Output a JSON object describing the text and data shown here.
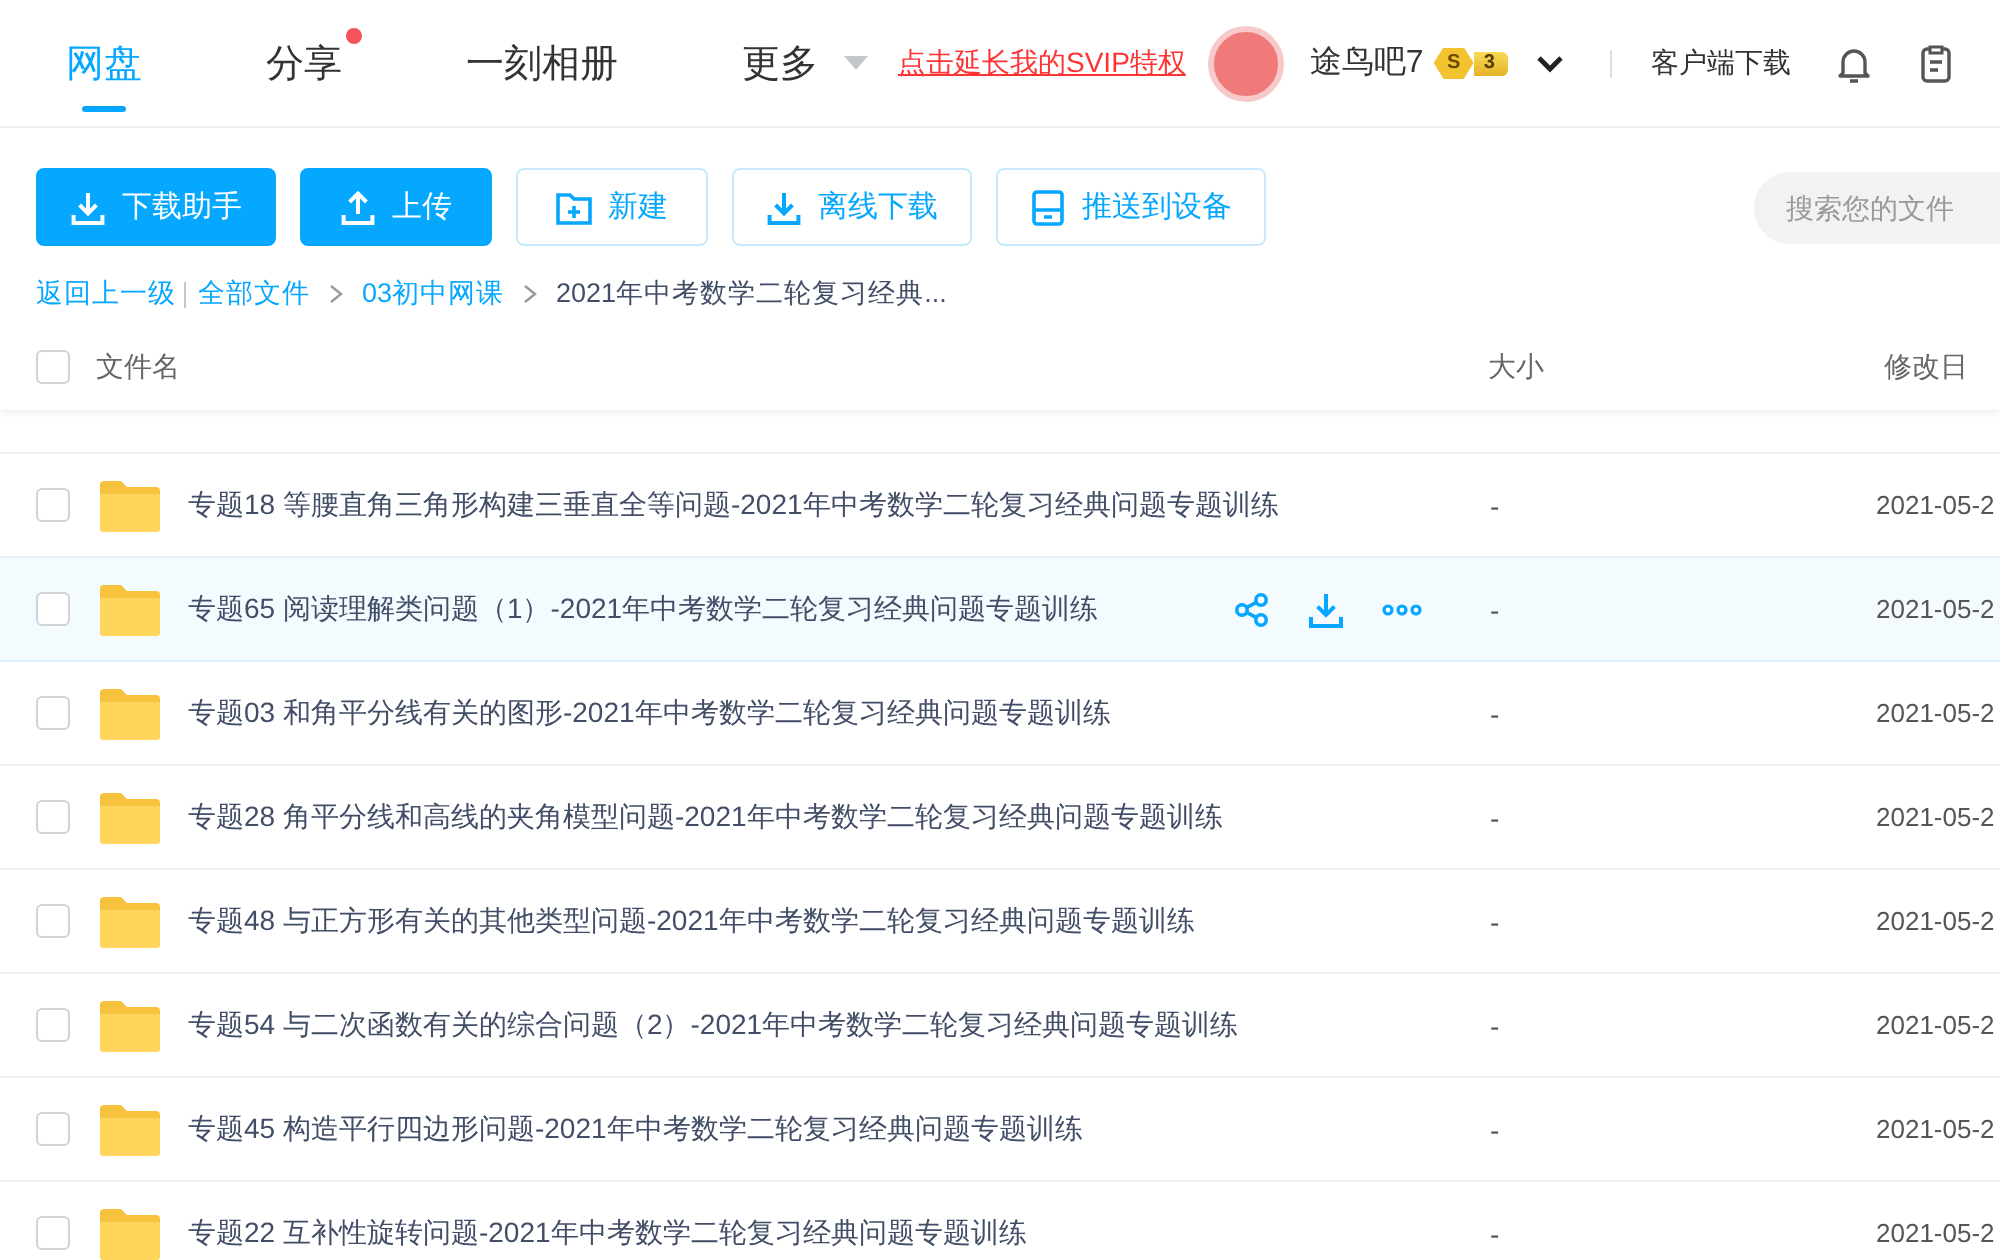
{
  "nav": {
    "tabs": [
      {
        "label": "网盘",
        "selected": true,
        "dot": false
      },
      {
        "label": "分享",
        "selected": false,
        "dot": true
      },
      {
        "label": "一刻相册",
        "selected": false,
        "dot": false
      },
      {
        "label": "更多",
        "selected": false,
        "dot": false,
        "dropdown": true
      }
    ],
    "promo_link": "点击延长我的SVIP特权",
    "user": {
      "name": "途鸟吧7",
      "badge_letter": "S",
      "badge_number": "3"
    },
    "client_download": "客户端下载"
  },
  "toolbar": {
    "buttons": [
      {
        "label": "下载助手",
        "kind": "download",
        "filled": true
      },
      {
        "label": "上传",
        "kind": "upload",
        "filled": true
      },
      {
        "label": "新建",
        "kind": "new-folder",
        "filled": false
      },
      {
        "label": "离线下载",
        "kind": "offline-download",
        "filled": false
      },
      {
        "label": "推送到设备",
        "kind": "push-to-device",
        "filled": false
      }
    ],
    "search": {
      "placeholder": "搜索您的文件"
    }
  },
  "breadcrumb": {
    "back": "返回上一级",
    "path": [
      {
        "label": "全部文件",
        "link": true
      },
      {
        "label": "03初中网课",
        "link": true
      },
      {
        "label": "2021年中考数学二轮复习经典...",
        "link": false
      }
    ]
  },
  "table": {
    "columns": [
      "文件名",
      "大小",
      "修改日"
    ],
    "all_checked": false,
    "rows": [
      {
        "name": "专题18 等腰直角三角形构建三垂直全等问题-2021年中考数学二轮复习经典问题专题训练",
        "size": "-",
        "modified": "2021-05-2",
        "checked": false,
        "hovered": false
      },
      {
        "name": "专题65 阅读理解类问题（1）-2021年中考数学二轮复习经典问题专题训练",
        "size": "-",
        "modified": "2021-05-2",
        "checked": false,
        "hovered": true
      },
      {
        "name": "专题03 和角平分线有关的图形-2021年中考数学二轮复习经典问题专题训练",
        "size": "-",
        "modified": "2021-05-2",
        "checked": false,
        "hovered": false
      },
      {
        "name": "专题28 角平分线和高线的夹角模型问题-2021年中考数学二轮复习经典问题专题训练",
        "size": "-",
        "modified": "2021-05-2",
        "checked": false,
        "hovered": false
      },
      {
        "name": "专题48 与正方形有关的其他类型问题-2021年中考数学二轮复习经典问题专题训练",
        "size": "-",
        "modified": "2021-05-2",
        "checked": false,
        "hovered": false
      },
      {
        "name": "专题54 与二次函数有关的综合问题（2）-2021年中考数学二轮复习经典问题专题训练",
        "size": "-",
        "modified": "2021-05-2",
        "checked": false,
        "hovered": false
      },
      {
        "name": "专题45 构造平行四边形问题-2021年中考数学二轮复习经典问题专题训练",
        "size": "-",
        "modified": "2021-05-2",
        "checked": false,
        "hovered": false
      },
      {
        "name": "专题22 互补性旋转问题-2021年中考数学二轮复习经典问题专题训练",
        "size": "-",
        "modified": "2021-05-2",
        "checked": false,
        "hovered": false
      }
    ]
  }
}
